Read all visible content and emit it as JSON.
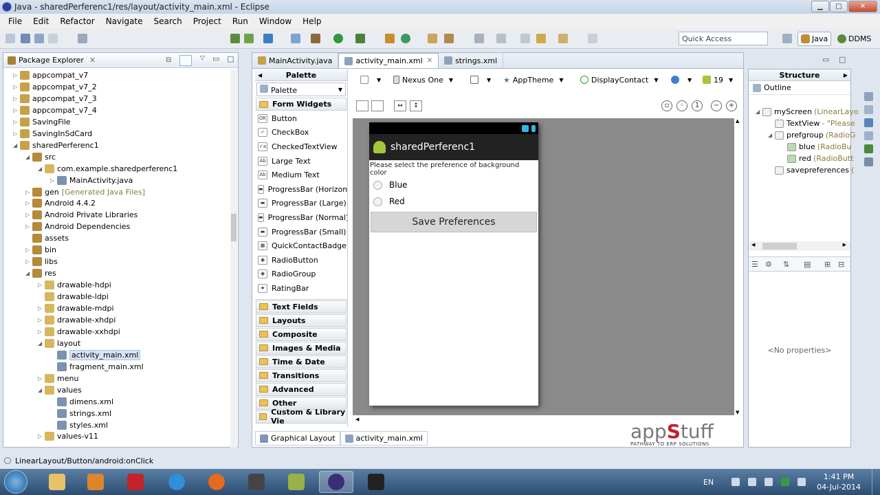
{
  "window": {
    "title": "Java - sharedPerferenc1/res/layout/activity_main.xml - Eclipse",
    "minimize": "▁",
    "maximize": "□",
    "close": "✕"
  },
  "menu": [
    "File",
    "Edit",
    "Refactor",
    "Navigate",
    "Search",
    "Project",
    "Run",
    "Window",
    "Help"
  ],
  "toolbar": {
    "quick_access": "Quick Access",
    "perspective_java": "Java",
    "perspective_ddms": "DDMS"
  },
  "package_explorer": {
    "title": "Package Explorer",
    "tree": [
      {
        "label": "appcompat_v7",
        "level": 0,
        "expanded": false
      },
      {
        "label": "appcompat_v7_2",
        "level": 0,
        "expanded": false
      },
      {
        "label": "appcompat_v7_3",
        "level": 0,
        "expanded": false
      },
      {
        "label": "appcompat_v7_4",
        "level": 0,
        "expanded": false
      },
      {
        "label": "SavingFile",
        "level": 0,
        "expanded": false
      },
      {
        "label": "SavingInSdCard",
        "level": 0,
        "expanded": false
      },
      {
        "label": "sharedPerferenc1",
        "level": 0,
        "expanded": true
      },
      {
        "label": "src",
        "level": 1,
        "expanded": true
      },
      {
        "label": "com.example.sharedperferenc1",
        "level": 2,
        "expanded": true
      },
      {
        "label": "MainActivity.java",
        "level": 3,
        "expanded": false
      },
      {
        "label": "gen",
        "decor": "[Generated Java Files]",
        "level": 1,
        "expanded": false
      },
      {
        "label": "Android 4.4.2",
        "level": 1,
        "expanded": false
      },
      {
        "label": "Android Private Libraries",
        "level": 1,
        "expanded": false
      },
      {
        "label": "Android Dependencies",
        "level": 1,
        "expanded": false
      },
      {
        "label": "assets",
        "level": 1,
        "expanded": null
      },
      {
        "label": "bin",
        "level": 1,
        "expanded": false
      },
      {
        "label": "libs",
        "level": 1,
        "expanded": false
      },
      {
        "label": "res",
        "level": 1,
        "expanded": true
      },
      {
        "label": "drawable-hdpi",
        "level": 2,
        "expanded": false
      },
      {
        "label": "drawable-ldpi",
        "level": 2,
        "expanded": null
      },
      {
        "label": "drawable-mdpi",
        "level": 2,
        "expanded": false
      },
      {
        "label": "drawable-xhdpi",
        "level": 2,
        "expanded": false
      },
      {
        "label": "drawable-xxhdpi",
        "level": 2,
        "expanded": false
      },
      {
        "label": "layout",
        "level": 2,
        "expanded": true
      },
      {
        "label": "activity_main.xml",
        "level": 3,
        "expanded": null,
        "selected": true
      },
      {
        "label": "fragment_main.xml",
        "level": 3,
        "expanded": null
      },
      {
        "label": "menu",
        "level": 2,
        "expanded": false
      },
      {
        "label": "values",
        "level": 2,
        "expanded": true
      },
      {
        "label": "dimens.xml",
        "level": 3,
        "expanded": null
      },
      {
        "label": "strings.xml",
        "level": 3,
        "expanded": null
      },
      {
        "label": "styles.xml",
        "level": 3,
        "expanded": null
      },
      {
        "label": "values-v11",
        "level": 2,
        "expanded": false
      }
    ]
  },
  "editor": {
    "tabs": [
      {
        "label": "MainActivity.java",
        "active": false
      },
      {
        "label": "activity_main.xml",
        "active": true
      },
      {
        "label": "strings.xml",
        "active": false
      }
    ],
    "palette": {
      "title": "Palette",
      "dropdown": "Palette",
      "first_category": "Form Widgets",
      "items": [
        "Button",
        "CheckBox",
        "CheckedTextView",
        "Large Text",
        "Medium Text",
        "ProgressBar (Horizonta",
        "ProgressBar (Large)",
        "ProgressBar (Normal)",
        "ProgressBar (Small)",
        "QuickContactBadge",
        "RadioButton",
        "RadioGroup",
        "RatingBar"
      ],
      "categories": [
        "Text Fields",
        "Layouts",
        "Composite",
        "Images & Media",
        "Time & Date",
        "Transitions",
        "Advanced",
        "Other",
        "Custom & Library Vie"
      ]
    },
    "layout_toolbar": {
      "device": "Nexus One",
      "theme": "AppTheme",
      "activity": "DisplayContact",
      "api": "19"
    },
    "device": {
      "app_title": "sharedPerferenc1",
      "prompt": "Please select the preference of background color",
      "radio_blue": "Blue",
      "radio_red": "Red",
      "button": "Save Preferences"
    },
    "bottom_tabs": [
      {
        "label": "Graphical Layout",
        "active": true
      },
      {
        "label": "activity_main.xml",
        "active": false
      }
    ]
  },
  "structure": {
    "title": "Structure",
    "outline_label": "Outline",
    "tree": [
      {
        "label": "myScreen",
        "hint": "(LinearLayo",
        "level": 0
      },
      {
        "label": "TextView",
        "hint": "- \"Please",
        "level": 1
      },
      {
        "label": "prefgroup",
        "hint": "(RadioG",
        "level": 1
      },
      {
        "label": "blue",
        "hint": "(RadioBu",
        "level": 2
      },
      {
        "label": "red",
        "hint": "(RadioButt",
        "level": 2
      },
      {
        "label": "savepreferences",
        "hint": "(",
        "level": 1
      }
    ],
    "no_properties": "<No properties>"
  },
  "watermark": {
    "logo_a": "app",
    "logo_s": "S",
    "logo_b": "tuff",
    "tagline": "PATHWAY TO ERP SOLUTIONS"
  },
  "status_bar": {
    "text": "LinearLayout/Button/android:onClick"
  },
  "taskbar": {
    "language": "EN",
    "time": "1:41 PM",
    "date": "04-Jul-2014"
  }
}
